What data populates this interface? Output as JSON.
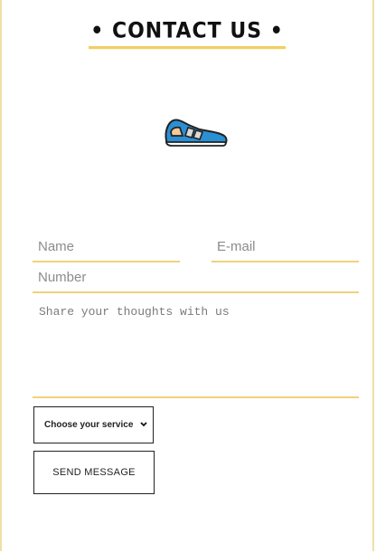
{
  "header": {
    "title": "• CONTACT US •"
  },
  "form": {
    "name_placeholder": "Name",
    "email_placeholder": "E-mail",
    "number_placeholder": "Number",
    "message_placeholder": "Share your thoughts with us",
    "service_select": "Choose your service",
    "send_label": "SEND MESSAGE"
  },
  "icons": {
    "shoe": "sneaker-icon",
    "select_arrow": "chevron-down-icon"
  },
  "colors": {
    "accent": "#f1cf63",
    "field_border": "#efd27a",
    "frame_border": "#f0e0a6",
    "shoe_blue": "#2b8fd3"
  }
}
